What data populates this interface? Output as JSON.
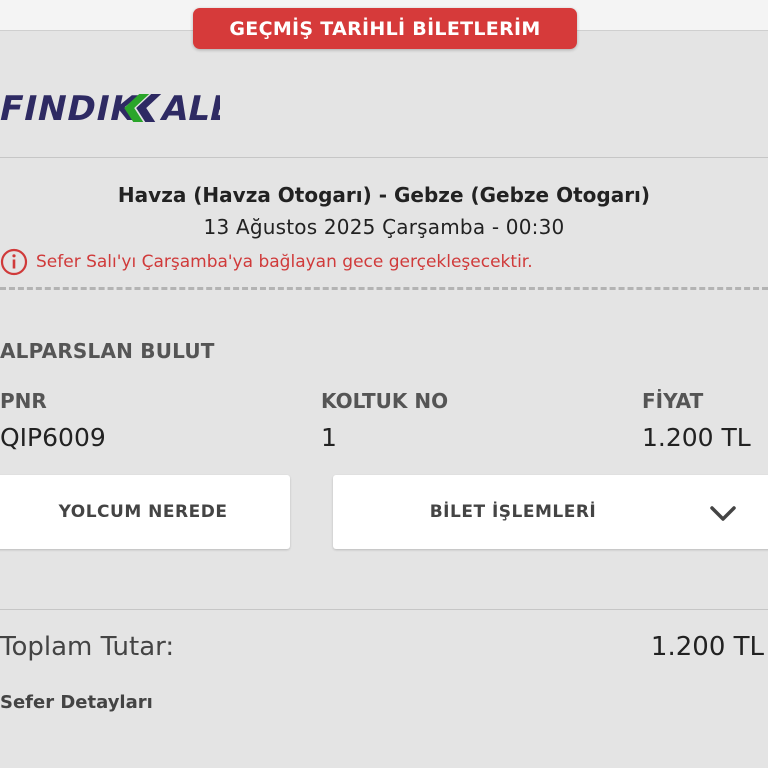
{
  "header": {
    "title": "GEÇMİŞ TARİHLİ BİLETLERİM"
  },
  "brand": {
    "logo_text": "FINDIKKALE",
    "color": "#2e2a63",
    "accent": "#2aa52a"
  },
  "trip": {
    "route": "Havza (Havza Otogarı) - Gebze (Gebze Otogarı)",
    "datetime": "13 Ağustos 2025 Çarşamba - 00:30",
    "warning": "Sefer Salı'yı Çarşamba'ya bağlayan gece gerçekleşecektir."
  },
  "passenger": {
    "name": "ALPARSLAN BULUT"
  },
  "ticket": {
    "pnr_label": "PNR",
    "pnr_value": "QIP6009",
    "seat_label": "KOLTUK NO",
    "seat_value": "1",
    "price_label": "FİYAT",
    "price_value": "1.200 TL"
  },
  "actions": {
    "where_label": "YOLCUM NEREDE",
    "ticket_ops_label": "BİLET İŞLEMLERİ"
  },
  "summary": {
    "total_label": "Toplam Tutar:",
    "total_value": "1.200 TL",
    "details_label": "Sefer Detayları"
  },
  "colors": {
    "badge": "#d63a3a",
    "warning": "#d03a3a",
    "card": "#e4e4e4"
  },
  "icons": {
    "warning": "info-circle-icon",
    "dropdown": "chevron-down-icon"
  }
}
